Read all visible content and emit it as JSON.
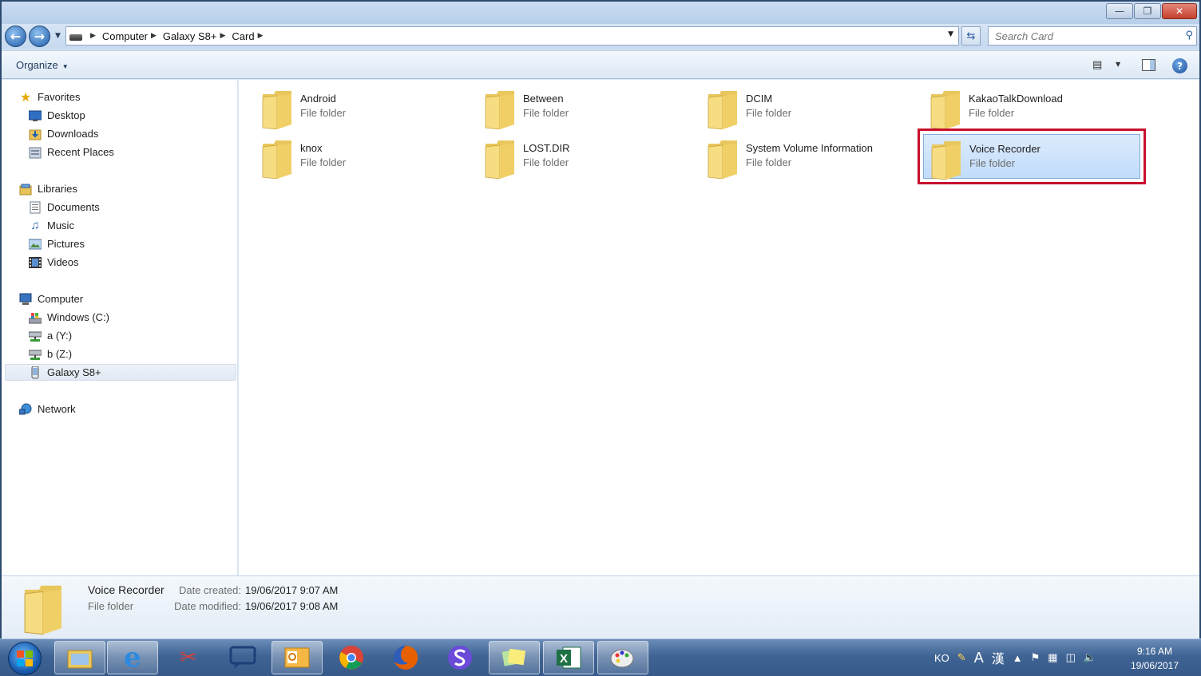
{
  "window": {
    "buttons": {
      "minimize": "—",
      "restore": "❐",
      "close": "✕"
    }
  },
  "address": {
    "breadcrumbs": [
      "Computer",
      "Galaxy S8+",
      "Card"
    ],
    "search_placeholder": "Search Card"
  },
  "toolbar": {
    "organize_label": "Organize"
  },
  "nav": {
    "favorites": {
      "label": "Favorites",
      "items": [
        "Desktop",
        "Downloads",
        "Recent Places"
      ]
    },
    "libraries": {
      "label": "Libraries",
      "items": [
        "Documents",
        "Music",
        "Pictures",
        "Videos"
      ]
    },
    "computer": {
      "label": "Computer",
      "items": [
        "Windows (C:)",
        "a (Y:)",
        "b (Z:)",
        "Galaxy S8+"
      ]
    },
    "network": {
      "label": "Network"
    }
  },
  "content": {
    "items": [
      {
        "name": "Android",
        "type": "File folder"
      },
      {
        "name": "Between",
        "type": "File folder"
      },
      {
        "name": "DCIM",
        "type": "File folder"
      },
      {
        "name": "KakaoTalkDownload",
        "type": "File folder"
      },
      {
        "name": "knox",
        "type": "File folder"
      },
      {
        "name": "LOST.DIR",
        "type": "File folder"
      },
      {
        "name": "System Volume Information",
        "type": "File folder"
      },
      {
        "name": "Voice Recorder",
        "type": "File folder"
      }
    ],
    "selected_item": "Voice Recorder"
  },
  "details": {
    "name": "Voice Recorder",
    "type": "File folder",
    "created_label": "Date created:",
    "created_value": "19/06/2017 9:07 AM",
    "modified_label": "Date modified:",
    "modified_value": "19/06/2017 9:08 AM"
  },
  "taskbar": {
    "apps": [
      "windows-explorer",
      "internet-explorer",
      "snipping-tool",
      "chat",
      "outlook",
      "chrome",
      "firefox",
      "app-s",
      "sticky-notes",
      "excel",
      "paint"
    ],
    "tray": {
      "lang": "KO",
      "ime_a": "A",
      "ime_han": "漢"
    },
    "clock": {
      "time": "9:16 AM",
      "date": "19/06/2017"
    }
  },
  "colors": {
    "highlight_box": "#c8102e",
    "selection": "#c1dcfb",
    "folder": "#f2d372"
  }
}
